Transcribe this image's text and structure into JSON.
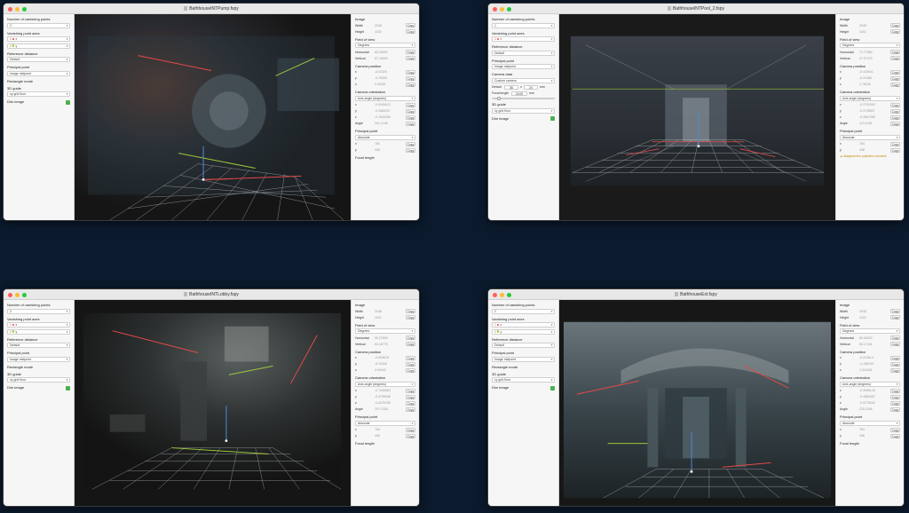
{
  "colors": {
    "background": "#0b1a2c",
    "red_line": "#e24a4a",
    "green_line": "#9cc83c",
    "grid": "#e6e6e6",
    "accent_check": "#4caf50"
  },
  "labels": {
    "num_vp": "Number of vanishing points",
    "vp_axes": "Vanishing point axes",
    "ref_distance": "Reference distance",
    "principal_point": "Principal point",
    "rectangle_mode": "Rectangle mode",
    "guide_3d": "3D guide",
    "dim_image": "Dim image",
    "image": "Image",
    "width": "Width",
    "height": "Height",
    "fov": "Field of view",
    "horizontal": "Horizontal",
    "vertical": "Vertical",
    "camera_position": "Camera position",
    "camera_orientation": "Camera orientation",
    "angle": "Angle",
    "principal_point_r": "Principal point",
    "focal_length": "Focal length",
    "camera_data": "Camera data",
    "copy": "Copy",
    "x": "x",
    "y": "y",
    "z": "z"
  },
  "windows": [
    {
      "title": "BathhouseINTPump.fspy",
      "num_vp": "2",
      "vp1": "x",
      "vp2": "y",
      "ref": "Default",
      "pp": "Image midpoint",
      "guide": "xy grid floor",
      "width": "2048",
      "height": "1152",
      "fov_unit": "Degrees",
      "fov_h": "80.25693",
      "fov_v": "57.16693",
      "pos": [
        "-4.01026",
        "-5.79009",
        "3.49251"
      ],
      "orient_mode": "Axis angle (degrees)",
      "orient": [
        "-0.0946913",
        "-0.2669037",
        "-0.1543289"
      ],
      "angle": "241.1246",
      "pp_mode": "Absolute",
      "pp_vals": [
        "784",
        "408"
      ],
      "vp_colors": [
        "#e24a4a",
        "#9cc83c"
      ]
    },
    {
      "title": "BathhouseINTPool_2.fspy",
      "num_vp": "1",
      "vp1": "x",
      "vp2": "",
      "ref": "Default",
      "pp": "Image midpoint",
      "guide": "xy grid floor",
      "width": "2048",
      "height": "1152",
      "fov_unit": "Degrees",
      "fov_h": "71.77880",
      "fov_v": "47.97373",
      "pos": [
        "-0.415941",
        "-5.31486",
        "1.78236"
      ],
      "orient_mode": "Axis angle (degrees)",
      "orient": [
        "-0.2792992",
        "-0.3728807",
        "-0.3067065"
      ],
      "angle": "113.4128",
      "pp_mode": "Absolute",
      "pp_vals": [
        "784",
        "408"
      ],
      "camera_data": "Custom camera",
      "sensor": [
        "36",
        "24",
        "mm"
      ],
      "focal": [
        "24.00",
        "mm"
      ],
      "warn": "Assignment to projection overwrite",
      "vp_colors": [
        "#e24a4a"
      ]
    },
    {
      "title": "BathhouseINTLobby.fspy",
      "num_vp": "2",
      "vp1": "x",
      "vp2": "y",
      "ref": "Default",
      "pp": "Image midpoint",
      "guide": "xy grid floor",
      "width": "2048",
      "height": "1152",
      "fov_unit": "Degrees",
      "fov_h": "95.27893",
      "fov_v": "63.16773",
      "pos": [
        "-0.504678",
        "-5.10495",
        "3.09443"
      ],
      "orient_mode": "Axis angle (degrees)",
      "orient": [
        "-0.7440663",
        "-0.4705038",
        "-0.4475785"
      ],
      "angle": "197.1328",
      "pp_mode": "Absolute",
      "pp_vals": [
        "784",
        "408"
      ],
      "vp_colors": [
        "#e24a4a",
        "#9cc83c"
      ]
    },
    {
      "title": "BathhouseExt.fspy",
      "num_vp": "2",
      "vp1": "x",
      "vp2": "y",
      "ref": "Default",
      "pp": "Image midpoint",
      "guide": "xy grid floor",
      "width": "2048",
      "height": "1152",
      "fov_unit": "Degrees",
      "fov_h": "80.06523",
      "fov_v": "56.17431",
      "pos": [
        "-6.213614",
        "-4.198249",
        "1.011049"
      ],
      "orient_mode": "Axis angle (degrees)",
      "orient": [
        "-0.4508143",
        "-0.4880457",
        "-0.5775034"
      ],
      "angle": "220.2446",
      "pp_mode": "Absolute",
      "pp_vals": [
        "784",
        "408"
      ],
      "vp_colors": [
        "#e24a4a",
        "#9cc83c"
      ]
    }
  ]
}
